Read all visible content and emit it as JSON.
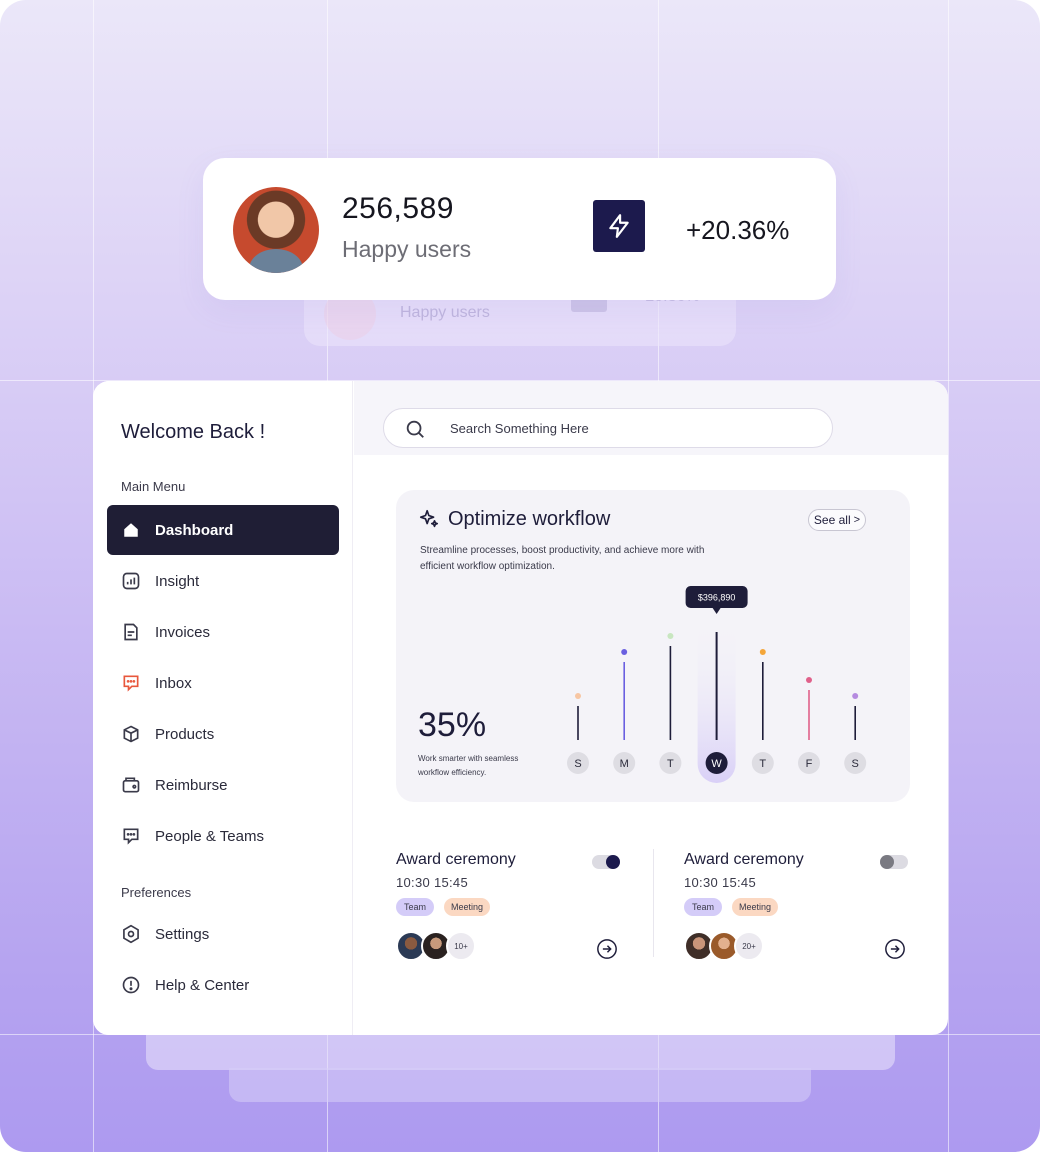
{
  "stats": {
    "number": "256,589",
    "label": "Happy users",
    "change": "+20.36%",
    "ghost_label": "Happy users",
    "ghost_change": "+20.36%"
  },
  "sidebar": {
    "welcome": "Welcome Back !",
    "main_menu_label": "Main Menu",
    "preferences_label": "Preferences",
    "items": [
      {
        "label": "Dashboard",
        "icon": "home-icon",
        "active": true
      },
      {
        "label": "Insight",
        "icon": "chart-icon"
      },
      {
        "label": "Invoices",
        "icon": "invoice-icon"
      },
      {
        "label": "Inbox",
        "icon": "chat-icon"
      },
      {
        "label": "Products",
        "icon": "box-icon"
      },
      {
        "label": "Reimburse",
        "icon": "wallet-icon"
      },
      {
        "label": "People & Teams",
        "icon": "people-chat-icon"
      }
    ],
    "prefs": [
      {
        "label": "Settings",
        "icon": "gear-icon"
      },
      {
        "label": "Help & Center",
        "icon": "info-icon"
      }
    ]
  },
  "search": {
    "placeholder": "Search Something Here"
  },
  "workflow": {
    "title": "Optimize workflow",
    "see_all": "See all",
    "description": "Streamline processes, boost productivity, and achieve more with efficient workflow optimization.",
    "percent": "35%",
    "subtext": "Work smarter with seamless workflow efficiency.",
    "tooltip": "$396,890"
  },
  "chart_data": {
    "type": "bar",
    "categories": [
      "S",
      "M",
      "T",
      "W",
      "T",
      "F",
      "S"
    ],
    "values": [
      50,
      94,
      110,
      124,
      94,
      66,
      50
    ],
    "highlight_index": 3,
    "dot_colors": [
      "#f7c6a3",
      "#6a5fe0",
      "#c8e6c0",
      "#1e1d3a",
      "#f4a63a",
      "#e0608a",
      "#b58ae0"
    ],
    "bar_colors": [
      "#1e1d3a",
      "#6a5fe0",
      "#1e1d3a",
      "#1e1d3a",
      "#1e1d3a",
      "#e0608a",
      "#1e1d3a"
    ]
  },
  "events": [
    {
      "title": "Award ceremony",
      "time": "10:30  15:45",
      "tag1": "Team",
      "tag2": "Meeting",
      "count": "10+",
      "toggle_on": true
    },
    {
      "title": "Award ceremony",
      "time": "10:30  15:45",
      "tag1": "Team",
      "tag2": "Meeting",
      "count": "20+",
      "toggle_on": false
    }
  ],
  "colors": {
    "accent": "#1c1a4d",
    "active_nav": "#1f1e35"
  }
}
